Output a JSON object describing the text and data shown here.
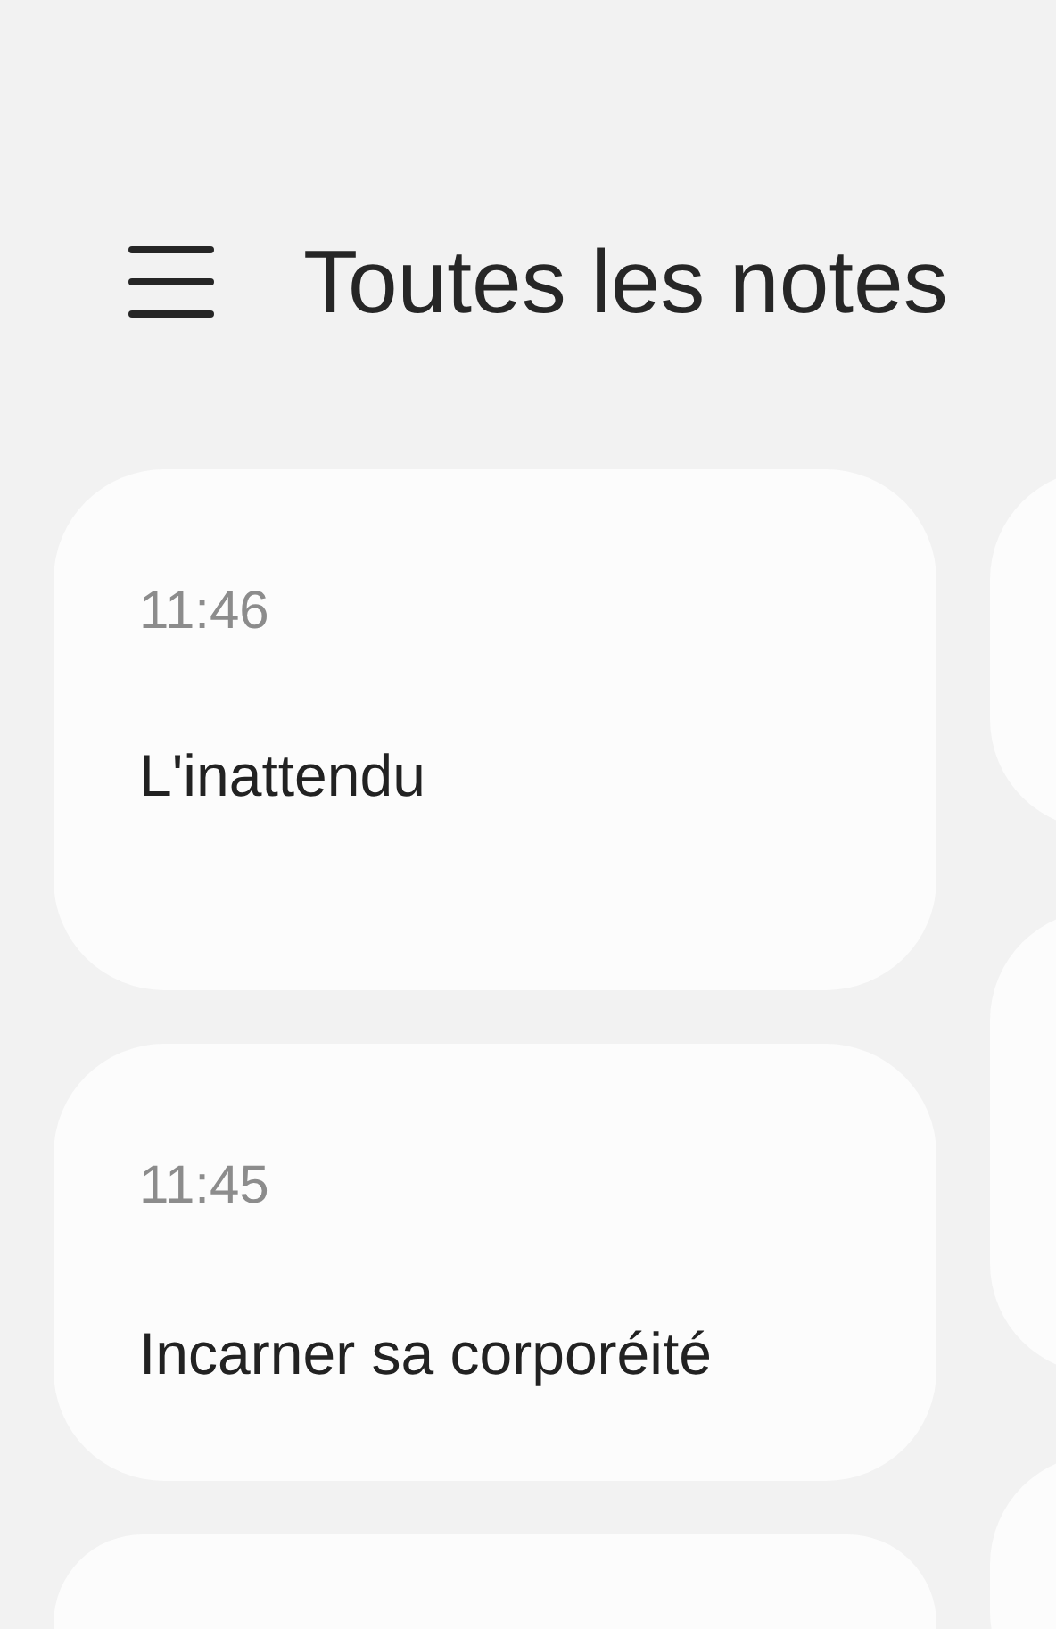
{
  "header": {
    "title": "Toutes les notes"
  },
  "notes": [
    {
      "time": "11:46",
      "title": "L'inattendu"
    },
    {
      "time": "11:45",
      "title": "Incarner sa corporéité"
    }
  ]
}
